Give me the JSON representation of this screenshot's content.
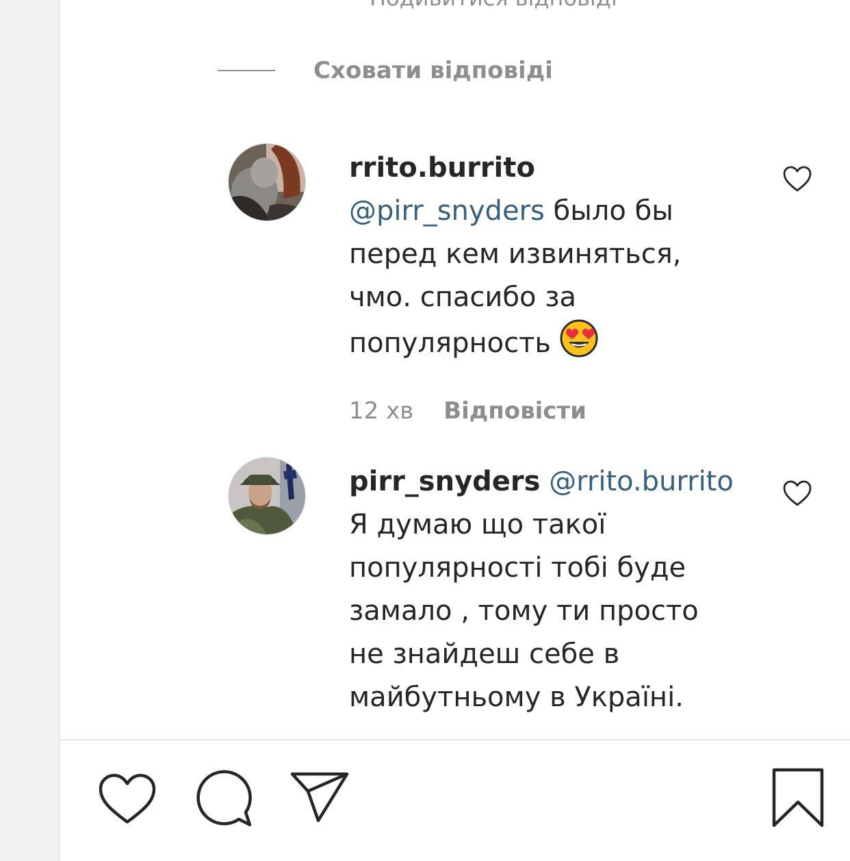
{
  "top_partial_text": "Подивитися відповіді",
  "replies_toggle": {
    "label": "Сховати відповіді"
  },
  "comments": [
    {
      "username": "rrito.burrito",
      "mention": "@pirr_snyders",
      "line1_rest": " было бы",
      "lines": [
        "перед кем извиняться,",
        "чмо. спасибо за"
      ],
      "last_line": "популярность ",
      "emoji": "smiling-face-with-heart-eyes",
      "time": "12 хв",
      "reply_label": "Відповісти"
    },
    {
      "username": "pirr_snyders",
      "mention": "@rrito.burrito",
      "lines": [
        "Я думаю що такої",
        "популярності тобі буде",
        "замало , тому ти просто",
        "не знайдеш себе в",
        "майбутньому в Україні."
      ]
    }
  ],
  "colors": {
    "mention": "#37607f",
    "muted": "#8e8e8e",
    "text": "#262626"
  },
  "action_icons": [
    "heart-icon",
    "comment-icon",
    "share-icon",
    "bookmark-icon"
  ]
}
